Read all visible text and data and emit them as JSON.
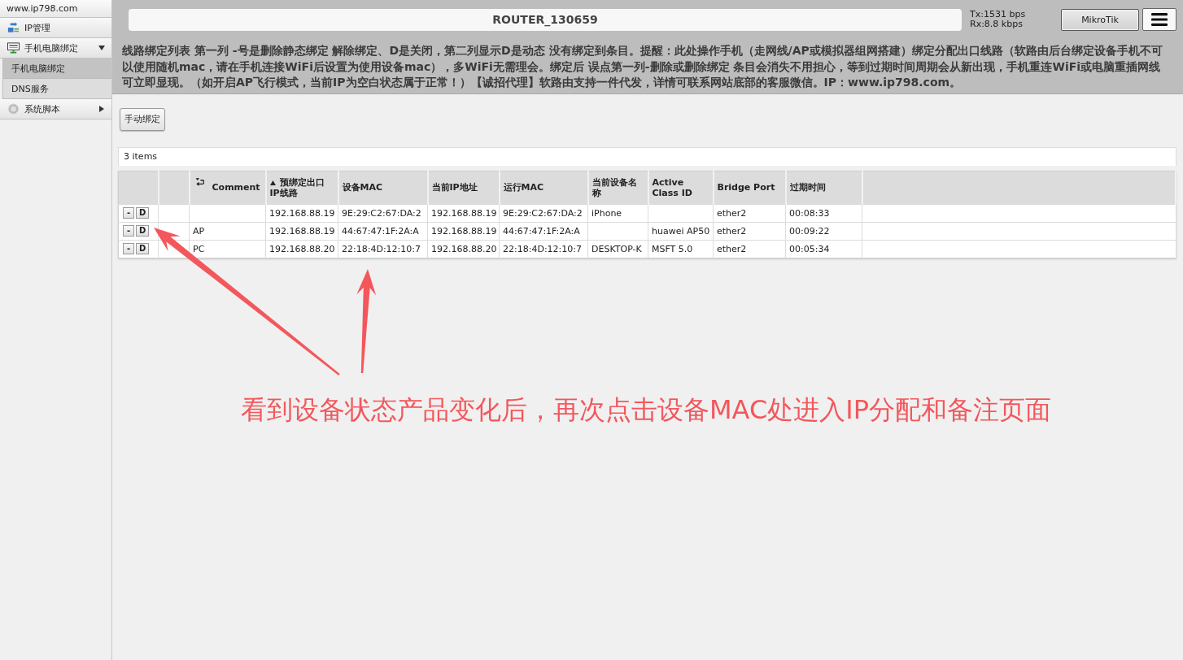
{
  "sidebar": {
    "site": "www.ip798.com",
    "items": [
      {
        "label": "IP管理",
        "kind": "link"
      },
      {
        "label": "手机电脑绑定",
        "kind": "group",
        "expanded": true,
        "children": [
          {
            "label": "手机电脑绑定",
            "selected": true
          },
          {
            "label": "DNS服务",
            "selected": false
          }
        ]
      },
      {
        "label": "系统脚本",
        "kind": "group",
        "expanded": false
      }
    ]
  },
  "header": {
    "router_name": "ROUTER_130659",
    "tx": "Tx:1531 bps",
    "rx": "Rx:8.8 kbps",
    "brand_button": "MikroTik"
  },
  "notice": "线路绑定列表 第一列 -号是删除静态绑定 解除绑定、D是关闭，第二列显示D是动态 没有绑定到条目。提醒：此处操作手机（走网线/AP或模拟器组网搭建）绑定分配出口线路（软路由后台绑定设备手机不可以使用随机mac，请在手机连接WiFi后设置为使用设备mac），多WiFi无需理会。绑定后 误点第一列-删除或删除绑定 条目会消失不用担心，等到过期时间周期会从新出现，手机重连WiFi或电脑重插网线可立即显现。（如开启AP飞行模式，当前IP为空白状态属于正常！）【诚招代理】软路由支持一件代发，详情可联系网站底部的客服微信。IP：www.ip798.com。",
  "toolbar": {
    "buttons": [
      "手动绑定"
    ]
  },
  "table": {
    "item_count": "3 items",
    "columns": [
      {
        "label": "Comment",
        "sorted": false
      },
      {
        "label": "预绑定出口IP线路",
        "sorted": true
      },
      {
        "label": "设备MAC",
        "sorted": false
      },
      {
        "label": "当前IP地址",
        "sorted": false
      },
      {
        "label": "运行MAC",
        "sorted": false
      },
      {
        "label": "当前设备名称",
        "sorted": false
      },
      {
        "label": "Active Class ID",
        "sorted": false
      },
      {
        "label": "Bridge Port",
        "sorted": false
      },
      {
        "label": "过期时间",
        "sorted": false
      }
    ],
    "rows": [
      {
        "actions": [
          "-",
          "D"
        ],
        "preset_ip_route": "192.168.88.19",
        "device_mac": "9E:29:C2:67:DA:2",
        "current_ip": "192.168.88.19",
        "running_mac": "9E:29:C2:67:DA:2",
        "device_name": "iPhone",
        "bridge_port": "ether2",
        "expire_time": "00:08:33"
      },
      {
        "actions": [
          "-",
          "D"
        ],
        "comment": "AP",
        "preset_ip_route": "192.168.88.19",
        "device_mac": "44:67:47:1F:2A:A",
        "current_ip": "192.168.88.19",
        "running_mac": "44:67:47:1F:2A:A",
        "active_class_id": "huawei AP50",
        "bridge_port": "ether2",
        "expire_time": "00:09:22"
      },
      {
        "actions": [
          "-",
          "D"
        ],
        "comment": "PC",
        "preset_ip_route": "192.168.88.20",
        "device_mac": "22:18:4D:12:10:7",
        "current_ip": "192.168.88.20",
        "running_mac": "22:18:4D:12:10:7",
        "device_name": "DESKTOP-K",
        "active_class_id": "MSFT 5.0",
        "bridge_port": "ether2",
        "expire_time": "00:05:34"
      }
    ]
  },
  "annotation": {
    "text": "看到设备状态产品变化后，再次点击设备MAC处进入IP分配和备注页面"
  }
}
